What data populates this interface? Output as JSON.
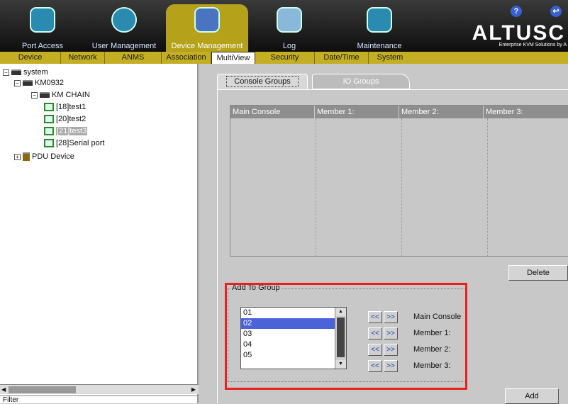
{
  "top_nav": [
    {
      "label": "Port Access",
      "icon": "port-access-icon"
    },
    {
      "label": "User Management",
      "icon": "users-icon"
    },
    {
      "label": "Device Management",
      "icon": "device-management-icon"
    },
    {
      "label": "Log",
      "icon": "log-icon"
    },
    {
      "label": "Maintenance",
      "icon": "maintenance-icon"
    }
  ],
  "brand": {
    "logo": "ALTUSC",
    "tagline": "Enterprise KVM Solutions by A"
  },
  "help_glyph": "?",
  "logout_glyph": "↩",
  "sub_nav": [
    "Device",
    "Network",
    "ANMS",
    "Association",
    "MultiView",
    "Security",
    "Date/Time",
    "System"
  ],
  "tree": {
    "root": "system",
    "device": "KM0932",
    "chain": "KM CHAIN",
    "ports": [
      "[18]test1",
      "[20]test2",
      "[21]test3",
      "[28]Serial port"
    ],
    "selected_port": "[21]test3",
    "pdu": "PDU Device"
  },
  "filter_label": "Filter",
  "tabs": {
    "console_groups": "Console Groups",
    "io_groups": "IO Groups"
  },
  "grid_headers": [
    "Main Console",
    "Member 1:",
    "Member 2:",
    "Member 3:"
  ],
  "buttons": {
    "delete": "Delete",
    "add": "Add",
    "move_left": "<<",
    "move_right": ">>"
  },
  "add_to_group": {
    "legend": "Add To Group",
    "list": [
      "01",
      "02",
      "03",
      "04",
      "05"
    ],
    "selected": "02",
    "roles": [
      "Main Console",
      "Member 1:",
      "Member 2:",
      "Member 3:"
    ]
  },
  "colors": {
    "accent": "#c4ae24",
    "highlight": "#e8201e",
    "selection": "#4a63d8"
  }
}
